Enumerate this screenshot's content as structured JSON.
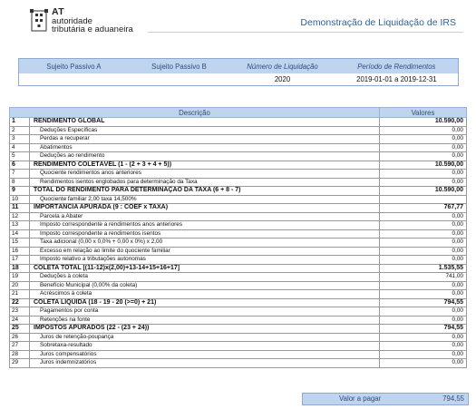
{
  "header": {
    "org_abbr": "AT",
    "org_line1": "autoridade",
    "org_line2": "tributária e aduaneira",
    "doc_title": "Demonstração de Liquidação de IRS"
  },
  "info": {
    "headers": [
      "Sujeito Passivo A",
      "Sujeito Passivo B",
      "Número de Liquidação",
      "Período de Rendimentos"
    ],
    "values": [
      "",
      "",
      "2020",
      "2019-01-01 a 2019-12-31"
    ]
  },
  "table": {
    "col_desc": "Descrição",
    "col_val": "Valores",
    "rows": [
      {
        "n": "1",
        "d": "RENDIMENTO GLOBAL",
        "v": "10.590,00",
        "b": true
      },
      {
        "n": "2",
        "d": "Deduções Específicas",
        "v": "0,00"
      },
      {
        "n": "3",
        "d": "Perdas a recuperar",
        "v": "0,00"
      },
      {
        "n": "4",
        "d": "Abatimentos",
        "v": "0,00"
      },
      {
        "n": "5",
        "d": "Deduções ao rendimento",
        "v": "0,00"
      },
      {
        "n": "6",
        "d": "RENDIMENTO COLETÁVEL (1 - (2 + 3 + 4 + 5))",
        "v": "10.590,00",
        "b": true
      },
      {
        "n": "7",
        "d": "Quociente rendimentos anos anteriores",
        "v": "0,00"
      },
      {
        "n": "8",
        "d": "Rendimentos isentos englobados para determinação da Taxa",
        "v": "0,00"
      },
      {
        "n": "9",
        "d": "TOTAL DO RENDIMENTO PARA DETERMINAÇÃO DA TAXA (6 + 8 - 7)",
        "v": "10.590,00",
        "b": true
      },
      {
        "n": "10",
        "d": "Quociente familiar    2,00   taxa 14,500%",
        "v": ""
      },
      {
        "n": "11",
        "d": "IMPORTÂNCIA APURADA (9 : COEF x TAXA)",
        "v": "767,77",
        "b": true
      },
      {
        "n": "12",
        "d": "Parcela a Abater",
        "v": "0,00"
      },
      {
        "n": "13",
        "d": "Imposto correspondente a rendimentos anos anteriores",
        "v": "0,00"
      },
      {
        "n": "14",
        "d": "Imposto correspondente a rendimentos isentos",
        "v": "0,00"
      },
      {
        "n": "15",
        "d": "Taxa adicional (0,00 x 0,0% + 0,00 x 0%) x 2,00",
        "v": "0,00"
      },
      {
        "n": "16",
        "d": "Excesso em relação ao limite do quociente familiar",
        "v": "0,00"
      },
      {
        "n": "17",
        "d": "Imposto relativo a tributações autonomas",
        "v": "0,00"
      },
      {
        "n": "18",
        "d": "COLETA TOTAL   [(11-12)x(2,00)+13-14+15+16+17]",
        "v": "1.535,55",
        "b": true
      },
      {
        "n": "19",
        "d": "Deduções à coleta",
        "v": "741,00"
      },
      {
        "n": "20",
        "d": "Benefício Municipal   (0,00% da coleta)",
        "v": "0,00"
      },
      {
        "n": "21",
        "d": "Acréscimos à coleta",
        "v": "0,00"
      },
      {
        "n": "22",
        "d": "COLETA LÍQUIDA (18 - 19 - 20 (>=0) + 21)",
        "v": "794,55",
        "b": true
      },
      {
        "n": "23",
        "d": "Pagamentos por conta",
        "v": "0,00"
      },
      {
        "n": "24",
        "d": "Retenções na fonte",
        "v": "0,00"
      },
      {
        "n": "25",
        "d": "IMPOSTOS APURADOS (22 - (23 + 24))",
        "v": "794,55",
        "b": true
      },
      {
        "n": "26",
        "d": "Juros de retenção-poupança",
        "v": "0,00"
      },
      {
        "n": "27",
        "d": "Sobretaxa-resultado",
        "v": "0,00"
      },
      {
        "n": "28",
        "d": "Juros compensatórios",
        "v": "0,00"
      },
      {
        "n": "29",
        "d": "Juros indemnizatórios",
        "v": "0,00"
      }
    ]
  },
  "payment": {
    "label": "Valor a pagar",
    "value": "794,55"
  }
}
